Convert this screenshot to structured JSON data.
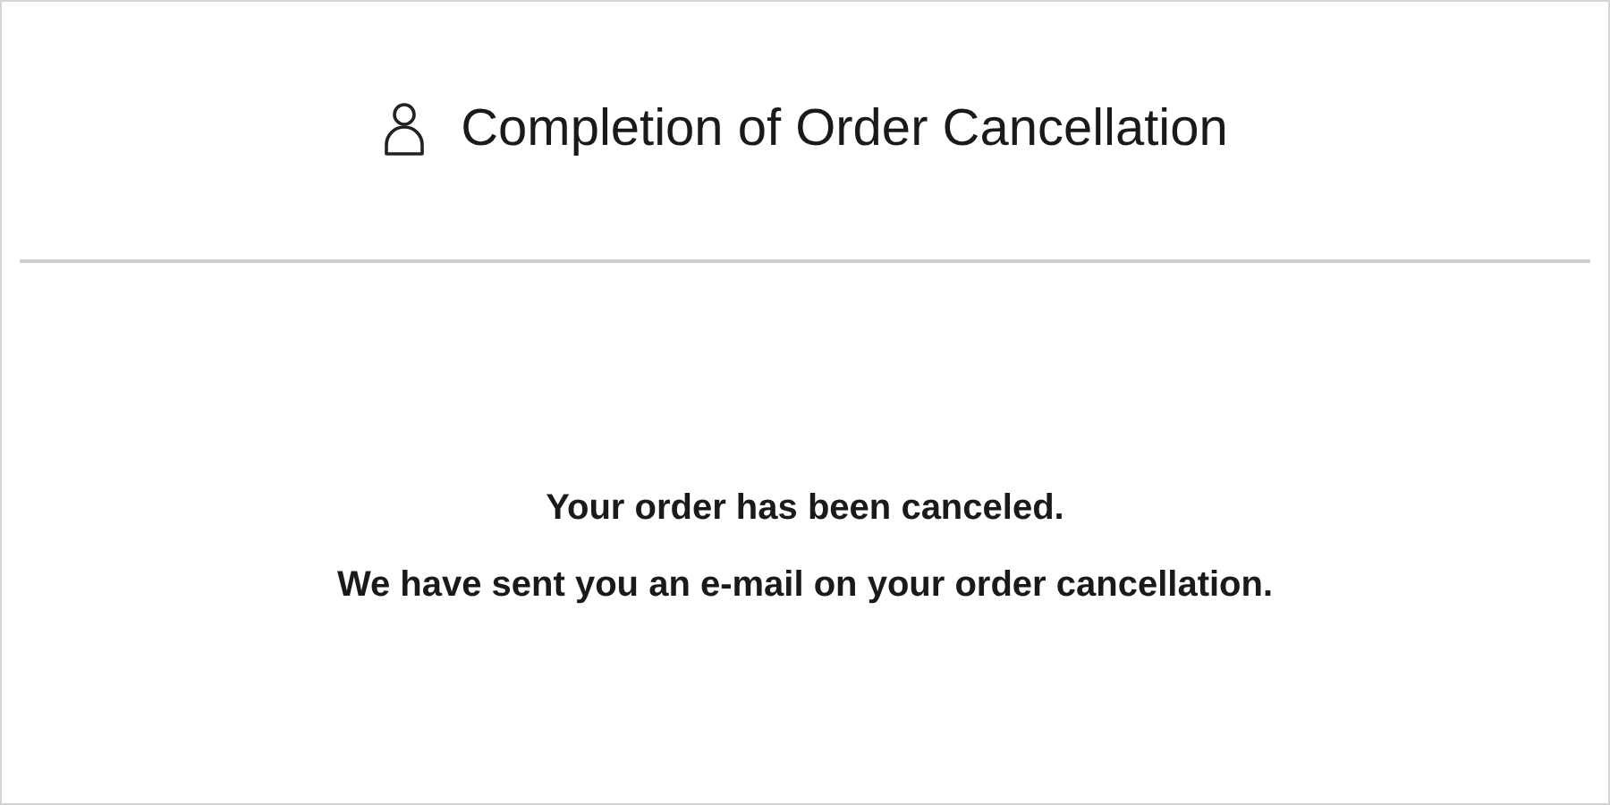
{
  "header": {
    "title": "Completion of Order Cancellation"
  },
  "message": {
    "lines": [
      "Your order has been canceled.",
      "We have sent you an e-mail on your order cancellation."
    ]
  }
}
